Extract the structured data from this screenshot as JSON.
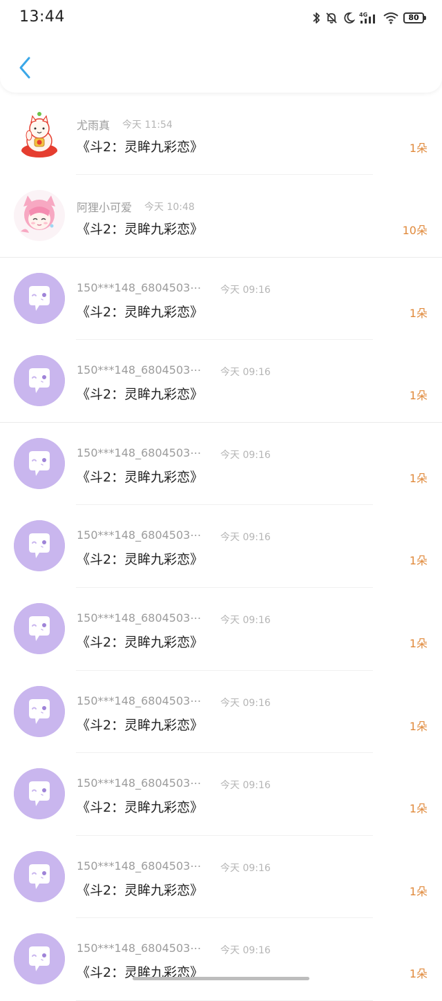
{
  "status_bar": {
    "time": "13:44",
    "network": "4G",
    "battery": "80",
    "icons": [
      "bluetooth-icon",
      "mute-icon",
      "moon-icon",
      "signal-icon",
      "wifi-icon",
      "battery-icon"
    ]
  },
  "header": {
    "back_icon": "chevron-left-icon"
  },
  "colors": {
    "accent_blue": "#3aa7e8",
    "count_orange": "#e08a3c",
    "default_avatar": "#c9b6ee"
  },
  "items": [
    {
      "name": "尤雨真",
      "time": "今天 11:54",
      "title": "《斗2：灵眸九彩恋》",
      "count": "1朵",
      "avatar": "lucky-cat-avatar"
    },
    {
      "name": "阿狸小可爱",
      "time": "今天 10:48",
      "title": "《斗2：灵眸九彩恋》",
      "count": "10朵",
      "avatar": "anime-catgirl-avatar"
    },
    {
      "name": "150***148_6804503⋯",
      "time": "今天 09:16",
      "title": "《斗2：灵眸九彩恋》",
      "count": "1朵",
      "avatar": "default-chat-avatar"
    },
    {
      "name": "150***148_6804503⋯",
      "time": "今天 09:16",
      "title": "《斗2：灵眸九彩恋》",
      "count": "1朵",
      "avatar": "default-chat-avatar"
    },
    {
      "name": "150***148_6804503⋯",
      "time": "今天 09:16",
      "title": "《斗2：灵眸九彩恋》",
      "count": "1朵",
      "avatar": "default-chat-avatar"
    },
    {
      "name": "150***148_6804503⋯",
      "time": "今天 09:16",
      "title": "《斗2：灵眸九彩恋》",
      "count": "1朵",
      "avatar": "default-chat-avatar"
    },
    {
      "name": "150***148_6804503⋯",
      "time": "今天 09:16",
      "title": "《斗2：灵眸九彩恋》",
      "count": "1朵",
      "avatar": "default-chat-avatar"
    },
    {
      "name": "150***148_6804503⋯",
      "time": "今天 09:16",
      "title": "《斗2：灵眸九彩恋》",
      "count": "1朵",
      "avatar": "default-chat-avatar"
    },
    {
      "name": "150***148_6804503⋯",
      "time": "今天 09:16",
      "title": "《斗2：灵眸九彩恋》",
      "count": "1朵",
      "avatar": "default-chat-avatar"
    },
    {
      "name": "150***148_6804503⋯",
      "time": "今天 09:16",
      "title": "《斗2：灵眸九彩恋》",
      "count": "1朵",
      "avatar": "default-chat-avatar"
    },
    {
      "name": "150***148_6804503⋯",
      "time": "今天 09:16",
      "title": "《斗2：灵眸九彩恋》",
      "count": "1朵",
      "avatar": "default-chat-avatar"
    }
  ]
}
